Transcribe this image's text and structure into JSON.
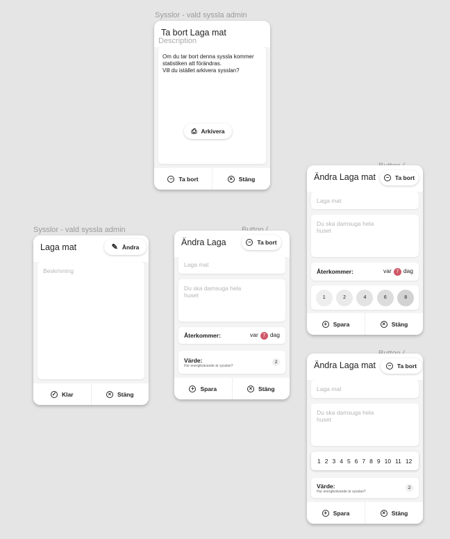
{
  "frames": {
    "admin_label": "Sysslor - vald syssla admin",
    "button_label": "Button (..."
  },
  "delete_dialog": {
    "title": "Ta bort Laga mat",
    "description_overlay": "Description",
    "message": "Om du tar bort denna syssla kommer statistiken att förändras.\nVill du istället arkivera sysslan?",
    "archive": "Arkivera",
    "delete": "Ta bort",
    "close": "Stäng"
  },
  "view_card": {
    "title": "Laga mat",
    "edit": "Ändra",
    "description_placeholder": "Beskrivning",
    "done": "Klar",
    "close": "Stäng"
  },
  "edit_card_1": {
    "title": "Ändra Laga",
    "delete": "Ta bort",
    "name_placeholder": "Laga mat",
    "desc_placeholder": "Du ska damsuga hela huset",
    "recurs_label": "Återkommer:",
    "recurs_prefix": "var",
    "recurs_value": "7",
    "recurs_unit": "dag",
    "value_label": "Värde:",
    "value_hint": "Hur energikrävande är sysslan?",
    "value": "2",
    "save": "Spara",
    "close": "Stäng"
  },
  "edit_card_2": {
    "title": "Ändra Laga mat",
    "delete": "Ta bort",
    "name_placeholder": "Laga mat",
    "desc_placeholder": "Du ska damsuga hela huset",
    "recurs_label": "Återkommer:",
    "recurs_prefix": "var",
    "recurs_value": "7",
    "recurs_unit": "dag",
    "values": [
      "1",
      "2",
      "4",
      "6",
      "8"
    ],
    "save": "Spara",
    "close": "Stäng"
  },
  "edit_card_3": {
    "title": "Ändra Laga mat",
    "delete": "Ta bort",
    "name_placeholder": "Laga mat",
    "desc_placeholder": "Du ska damsuga hela huset",
    "days": [
      "1",
      "2",
      "3",
      "4",
      "5",
      "6",
      "7",
      "8",
      "9",
      "10",
      "11",
      "12"
    ],
    "value_label": "Värde:",
    "value_hint": "Hur energikrävande är sysslan?",
    "value": "2",
    "save": "Spara",
    "close": "Stäng"
  },
  "colors": {
    "background": "#e5e5e5",
    "badge": "#cf5767"
  }
}
